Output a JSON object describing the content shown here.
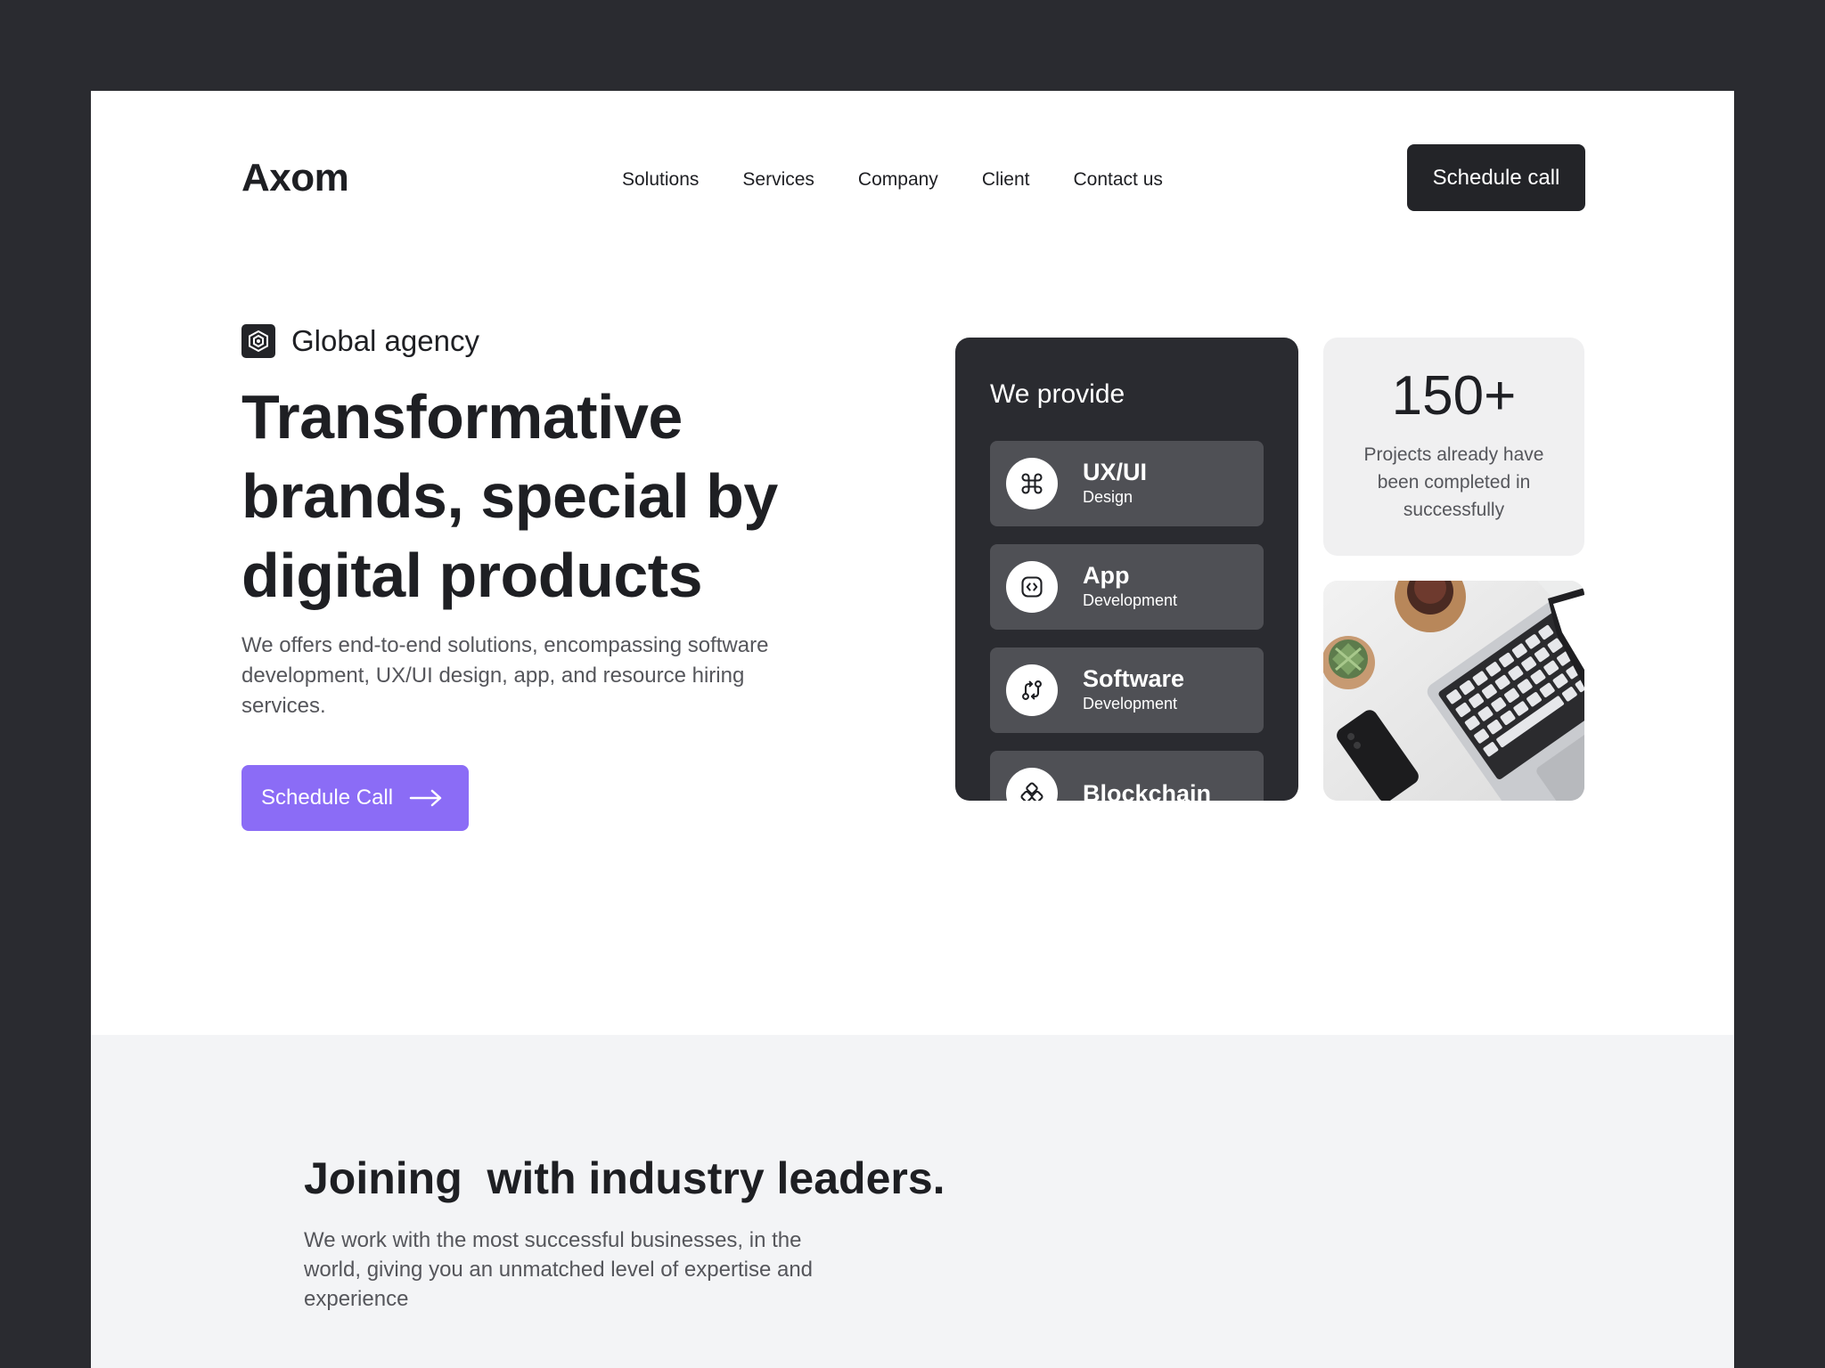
{
  "header": {
    "logo": "Axom",
    "nav": [
      "Solutions",
      "Services",
      "Company",
      "Client",
      "Contact us"
    ],
    "cta_label": "Schedule call"
  },
  "hero": {
    "tag": "Global agency",
    "title_lines": [
      "Transformative",
      "brands, special by",
      "digital products"
    ],
    "description": "We offers end-to-end solutions, encompassing software development, UX/UI design, app, and resource hiring services.",
    "cta_label": "Schedule Call"
  },
  "provide": {
    "title": "We provide",
    "items": [
      {
        "name": "UX/UI",
        "sub": "Design",
        "icon": "command-icon"
      },
      {
        "name": "App",
        "sub": "Development",
        "icon": "code-icon"
      },
      {
        "name": "Software",
        "sub": "Development",
        "icon": "git-compare-icon"
      },
      {
        "name": "Blockchain",
        "sub": "",
        "icon": "blockchain-icon"
      }
    ]
  },
  "stat": {
    "value": "150+",
    "text": "Projects already have been completed in successfully"
  },
  "leaders": {
    "title": "Joining  with industry leaders.",
    "description": "We work with the most successful businesses, in the world, giving you an unmatched level of expertise and experience"
  },
  "colors": {
    "dark": "#232428",
    "accent": "#8b6cf6",
    "page_frame": "#2a2b30"
  }
}
